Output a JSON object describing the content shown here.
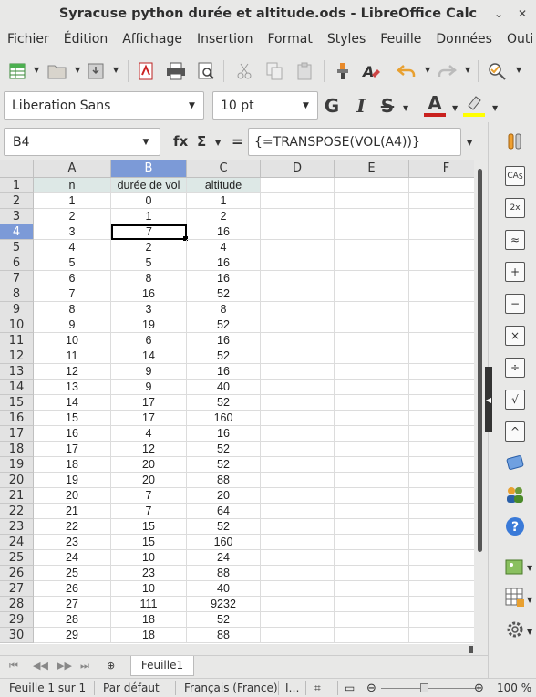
{
  "window": {
    "title": "Syracuse python durée et altitude.ods - LibreOffice Calc"
  },
  "menubar": [
    "Fichier",
    "Édition",
    "Affichage",
    "Insertion",
    "Format",
    "Styles",
    "Feuille",
    "Données",
    "Outi"
  ],
  "toolbar": {
    "icons": [
      "new-spreadsheet-icon",
      "open-folder-icon",
      "save-icon",
      "export-pdf-icon",
      "print-icon",
      "print-preview-icon",
      "cut-icon",
      "copy-icon",
      "paste-icon",
      "clone-format-icon",
      "clear-format-icon",
      "undo-icon",
      "redo-icon",
      "spellcheck-icon"
    ]
  },
  "format_toolbar": {
    "font_name": "Liberation Sans",
    "font_size": "10 pt",
    "bold": "G",
    "italic": "I",
    "strike": "S",
    "font_color_letter": "A",
    "font_color": "#c9211e",
    "highlight_color": "#ffff00"
  },
  "formula_bar": {
    "cell_ref": "B4",
    "fx": "fx",
    "sigma": "Σ",
    "equals": "=",
    "content": "{=TRANSPOSE(VOL(A4))}"
  },
  "grid": {
    "columns": [
      "A",
      "B",
      "C",
      "D",
      "E",
      "F"
    ],
    "selected_column": "B",
    "selected_row": "4",
    "active_cell": "B4",
    "header_row": [
      "n",
      "durée de vol",
      "altitude"
    ],
    "rows": [
      [
        "1",
        "0",
        "1"
      ],
      [
        "2",
        "1",
        "2"
      ],
      [
        "3",
        "7",
        "16"
      ],
      [
        "4",
        "2",
        "4"
      ],
      [
        "5",
        "5",
        "16"
      ],
      [
        "6",
        "8",
        "16"
      ],
      [
        "7",
        "16",
        "52"
      ],
      [
        "8",
        "3",
        "8"
      ],
      [
        "9",
        "19",
        "52"
      ],
      [
        "10",
        "6",
        "16"
      ],
      [
        "11",
        "14",
        "52"
      ],
      [
        "12",
        "9",
        "16"
      ],
      [
        "13",
        "9",
        "40"
      ],
      [
        "14",
        "17",
        "52"
      ],
      [
        "15",
        "17",
        "160"
      ],
      [
        "16",
        "4",
        "16"
      ],
      [
        "17",
        "12",
        "52"
      ],
      [
        "18",
        "20",
        "52"
      ],
      [
        "19",
        "20",
        "88"
      ],
      [
        "20",
        "7",
        "20"
      ],
      [
        "21",
        "7",
        "64"
      ],
      [
        "22",
        "15",
        "52"
      ],
      [
        "23",
        "15",
        "160"
      ],
      [
        "24",
        "10",
        "24"
      ],
      [
        "25",
        "23",
        "88"
      ],
      [
        "26",
        "10",
        "40"
      ],
      [
        "27",
        "111",
        "9232"
      ],
      [
        "28",
        "18",
        "52"
      ],
      [
        "29",
        "18",
        "88"
      ]
    ]
  },
  "sheet_tabs": {
    "active": "Feuille1"
  },
  "statusbar": {
    "sheet": "Feuille 1 sur 1",
    "style": "Par défaut",
    "language": "Français (France)",
    "zoom_minus": "⊖",
    "zoom_plus": "⊕",
    "zoom": "100 %",
    "zoom_level_percent": 100
  },
  "sidebar": {
    "icons": [
      "properties-icon",
      "ca-sup-icon",
      "2x-icon",
      "approx-icon",
      "plus-icon",
      "minus-icon",
      "times-icon",
      "divide-icon",
      "sqrt-icon",
      "caret-icon",
      "edit-icon",
      "users-icon",
      "help-icon",
      "insert-image-icon",
      "insert-table-icon",
      "settings-gear-icon"
    ]
  }
}
